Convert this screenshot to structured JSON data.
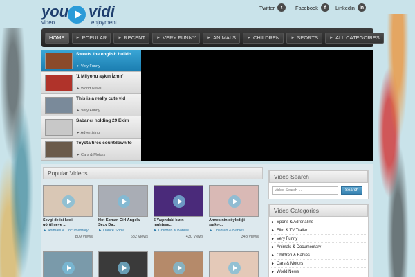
{
  "brand": {
    "you": "you",
    "vidi": "vidi",
    "tag_left": "video",
    "tag_right": "enjoyment"
  },
  "social": [
    {
      "label": "Twitter",
      "icon": "twitter-icon",
      "glyph": "t"
    },
    {
      "label": "Facebook",
      "icon": "facebook-icon",
      "glyph": "f"
    },
    {
      "label": "Linkedin",
      "icon": "linkedin-icon",
      "glyph": "in"
    }
  ],
  "nav": {
    "items": [
      "HOME",
      "POPULAR",
      "RECENT",
      "VERY FUNNY",
      "ANIMALS",
      "CHILDREN",
      "SPORTS",
      "ALL CATEGORIES"
    ]
  },
  "featured": [
    {
      "title": "Sweets the english bulldo",
      "category": "► Very Funny",
      "thumb": "#8a4a2a",
      "active": true
    },
    {
      "title": "'1 Milyonu aşkın İzmir'",
      "category": "► World News",
      "thumb": "#b0332a"
    },
    {
      "title": "This is a really cute vid",
      "category": "► Very Funny",
      "thumb": "#7a8a9a"
    },
    {
      "title": "Sabancı holding 29 Ekim",
      "category": "► Advertising",
      "thumb": "#c8c8c8"
    },
    {
      "title": "Toyota tires countdown to",
      "category": "► Cars & Motors",
      "thumb": "#6a5a4a"
    }
  ],
  "popular": {
    "heading": "Popular Videos",
    "videos": [
      {
        "title": "Sevgi delisi kedi görülmeye ...",
        "category": "► Animals & Documentary",
        "views": "809 Views",
        "thumb": "#d9c7b5"
      },
      {
        "title": "Hot Koman Girl Angela Sexy Da..",
        "category": "► Dance Show",
        "views": "682 Views",
        "thumb": "#a9adb5"
      },
      {
        "title": "5 Yaşındaki kızın muhteşe...",
        "category": "► Children & Babies",
        "views": "430 Views",
        "thumb": "#4a2a7a"
      },
      {
        "title": "Annesinin söylediği şarkıy...",
        "category": "► Children & Babies",
        "views": "348 Views",
        "thumb": "#d9b9b5"
      },
      {
        "title": "",
        "category": "",
        "views": "",
        "thumb": "#7a9aaa"
      },
      {
        "title": "",
        "category": "",
        "views": "",
        "thumb": "#3a3a3a"
      },
      {
        "title": "",
        "category": "",
        "views": "",
        "thumb": "#b58a6a"
      },
      {
        "title": "",
        "category": "",
        "views": "",
        "thumb": "#e4c9b8"
      }
    ]
  },
  "search": {
    "heading": "Video Search",
    "placeholder": "Video Search ...",
    "button": "Search"
  },
  "categories": {
    "heading": "Video Categories",
    "items": [
      "Sports & Adrenaline",
      "Film & TV Trailer",
      "Very Funny",
      "Animals & Documentary",
      "Children & Babies",
      "Cars & Motors",
      "World News"
    ]
  },
  "colors": {
    "background": "#c9e3ea",
    "accent": "#2a9bd8",
    "nav": "#2a2a2a"
  }
}
